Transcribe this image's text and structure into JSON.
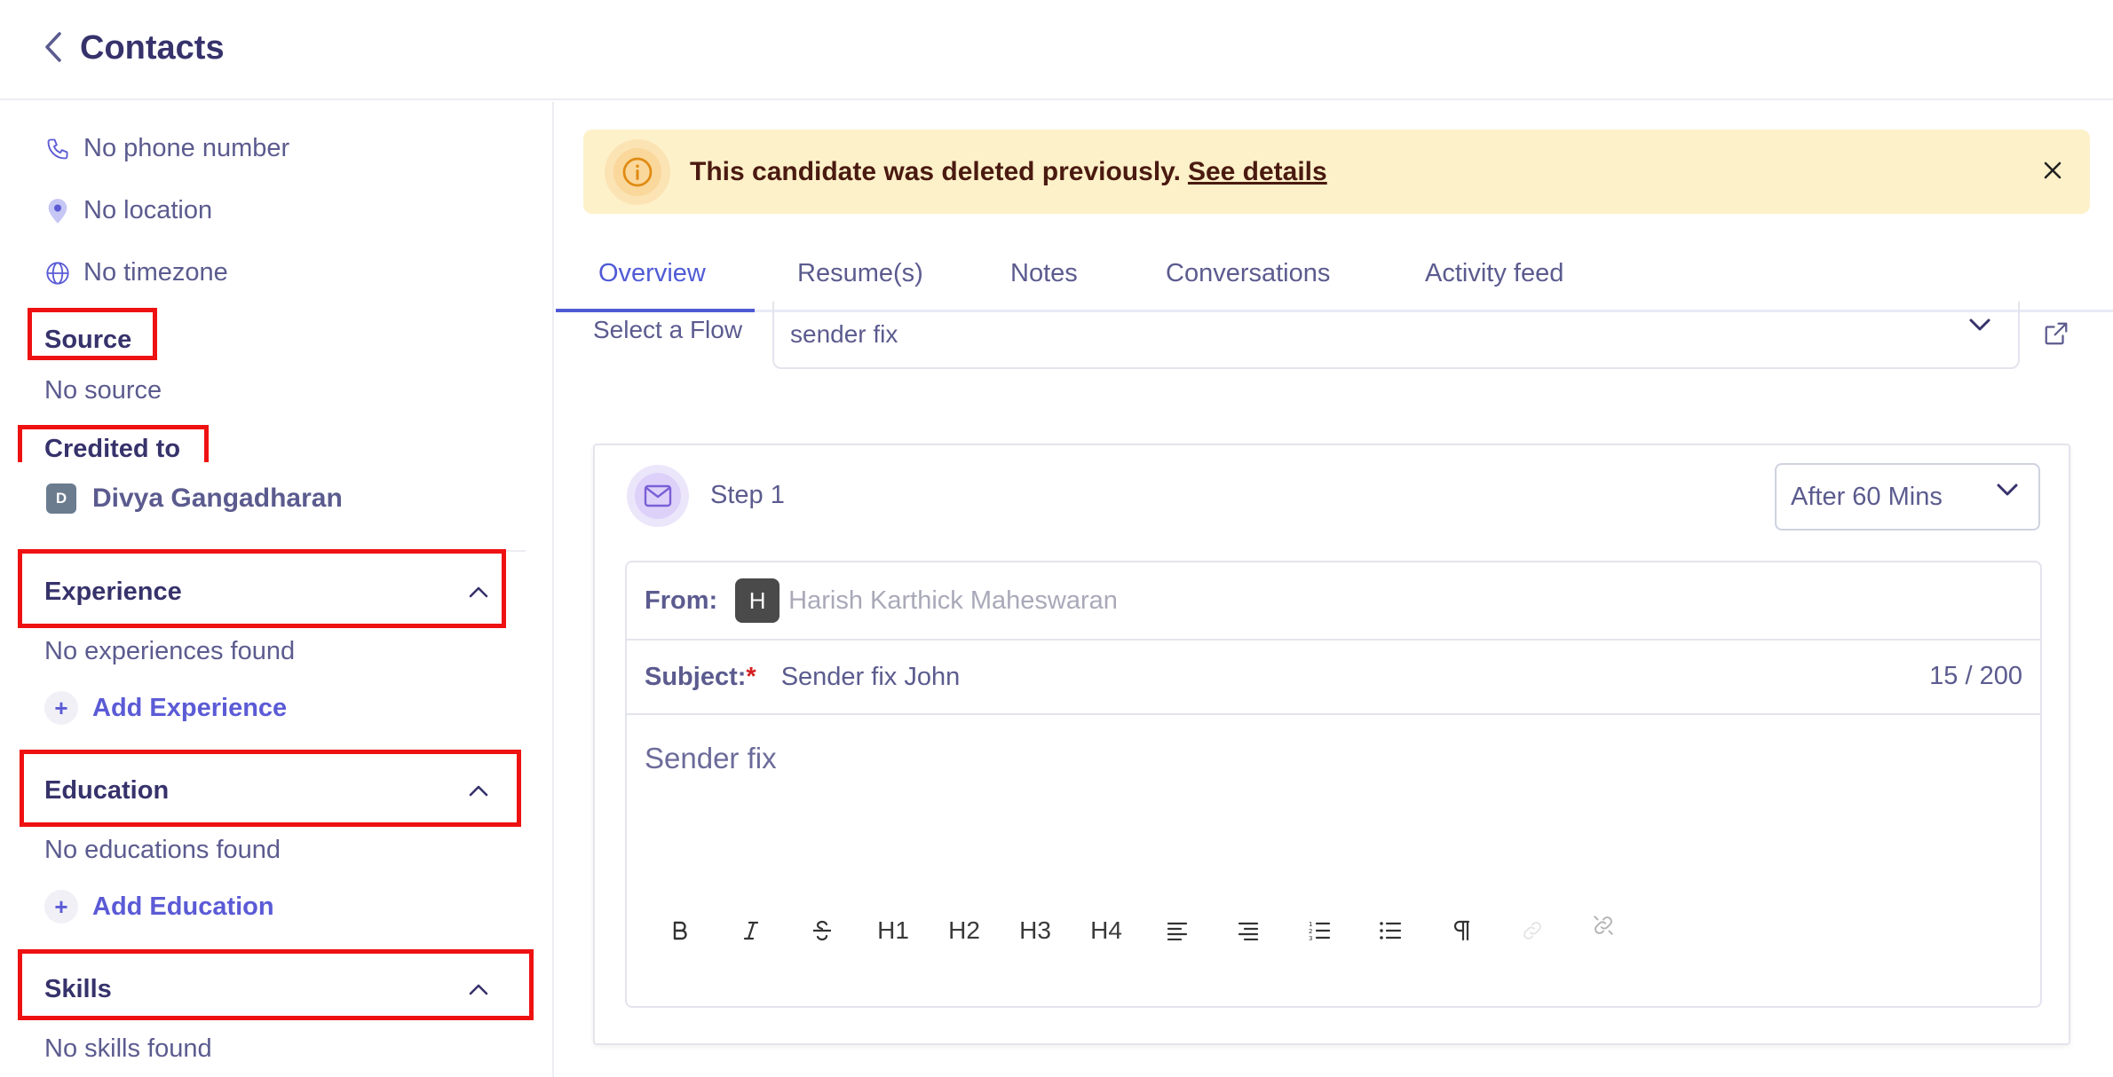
{
  "header": {
    "title": "Contacts"
  },
  "sidebar": {
    "phone": "No phone number",
    "location": "No location",
    "timezone": "No timezone",
    "source_label": "Source",
    "source_value": "No source",
    "credited_label": "Credited to",
    "credited_avatar": "D",
    "credited_name": "Divya Gangadharan",
    "experience": {
      "title": "Experience",
      "empty": "No experiences found",
      "add": "Add Experience"
    },
    "education": {
      "title": "Education",
      "empty": "No educations found",
      "add": "Add Education"
    },
    "skills": {
      "title": "Skills",
      "empty": "No skills found"
    }
  },
  "banner": {
    "message": "This candidate was deleted previously.",
    "link": "See details",
    "color": "#fdf1c9"
  },
  "tabs": [
    {
      "label": "Overview",
      "active": true
    },
    {
      "label": "Resume(s)"
    },
    {
      "label": "Notes"
    },
    {
      "label": "Conversations"
    },
    {
      "label": "Activity feed"
    }
  ],
  "flow": {
    "label": "Select a Flow",
    "value": "sender fix"
  },
  "step": {
    "title": "Step 1",
    "delay": "After 60 Mins",
    "from_label": "From:",
    "from_avatar": "H",
    "from_name": "Harish Karthick Maheswaran",
    "subject_label": "Subject:",
    "subject_required": "*",
    "subject_value": "Sender fix John",
    "subject_count": "15 / 200",
    "body": "Sender fix",
    "toolbar": [
      "bold",
      "italic",
      "strikethrough",
      "h1",
      "h2",
      "h3",
      "h4",
      "align-left",
      "align-right",
      "ordered-list",
      "bullet-list",
      "paragraph",
      "link",
      "unlink"
    ],
    "toolbar_labels": {
      "h1": "H1",
      "h2": "H2",
      "h3": "H3",
      "h4": "H4"
    }
  },
  "colors": {
    "accent": "#4f5bd5",
    "title": "#36326b",
    "text": "#5b5b8f",
    "highlight": "#ee1111"
  }
}
